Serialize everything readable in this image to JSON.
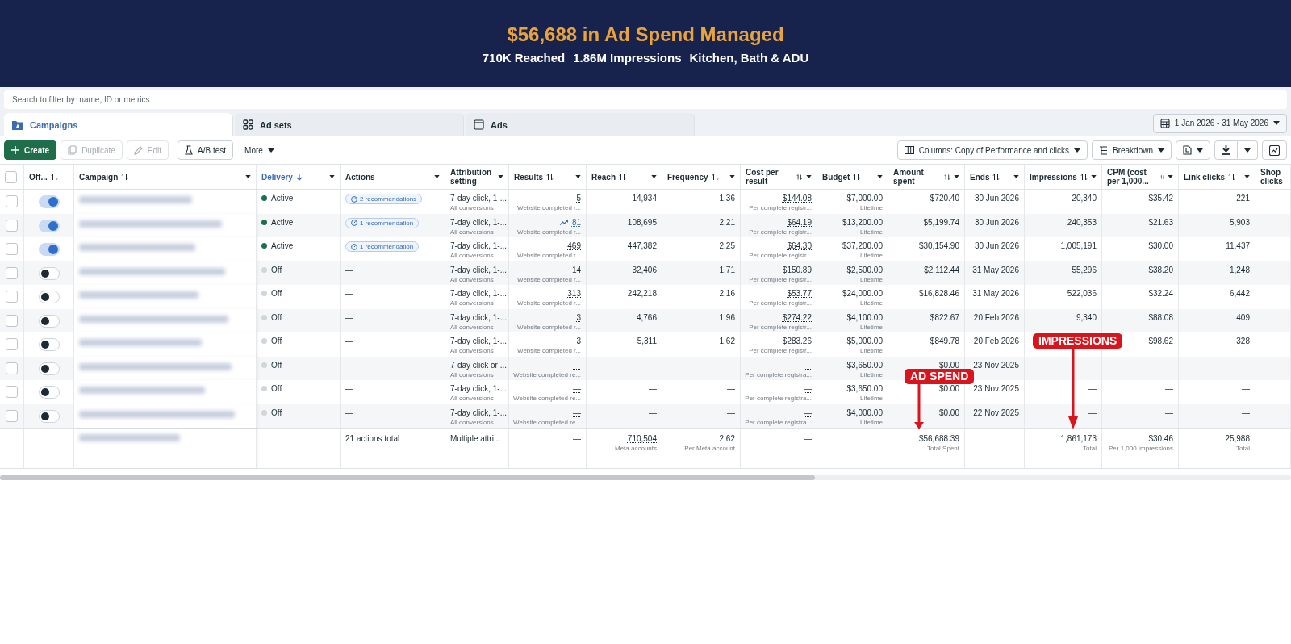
{
  "banner": {
    "title": "$56,688 in Ad Spend Managed",
    "stats": [
      "710K Reached",
      "1.86M Impressions",
      "Kitchen, Bath & ADU"
    ]
  },
  "search": {
    "placeholder": "Search to filter by: name, ID or metrics"
  },
  "tabs": [
    {
      "label": "Campaigns",
      "selected": true
    },
    {
      "label": "Ad sets",
      "selected": false
    },
    {
      "label": "Ads",
      "selected": false
    }
  ],
  "date_range": "1 Jan 2026 - 31 May 2026",
  "toolbar": {
    "create": "Create",
    "duplicate": "Duplicate",
    "edit": "Edit",
    "ab_test": "A/B test",
    "more": "More",
    "columns": "Columns: Copy of Performance and clicks",
    "breakdown": "Breakdown"
  },
  "table": {
    "all_checked": false,
    "columns": [
      {
        "label": "Off...",
        "sortable": true,
        "sorted": false,
        "menu": false
      },
      {
        "label": "Campaign",
        "sortable": true,
        "sorted": false,
        "menu": true
      },
      {
        "label": "Delivery",
        "sortable": true,
        "sorted": true,
        "menu": true
      },
      {
        "label": "Actions",
        "sortable": false,
        "sorted": false,
        "menu": true
      },
      {
        "label": "Attribution setting",
        "sortable": false,
        "sorted": false,
        "menu": true
      },
      {
        "label": "Results",
        "sortable": true,
        "sorted": false,
        "menu": true
      },
      {
        "label": "Reach",
        "sortable": true,
        "sorted": false,
        "menu": true
      },
      {
        "label": "Frequency",
        "sortable": true,
        "sorted": false,
        "menu": true
      },
      {
        "label": "Cost per result",
        "sortable": true,
        "sorted": false,
        "menu": true
      },
      {
        "label": "Budget",
        "sortable": true,
        "sorted": false,
        "menu": true
      },
      {
        "label": "Amount spent",
        "sortable": true,
        "sorted": false,
        "menu": true
      },
      {
        "label": "Ends",
        "sortable": true,
        "sorted": false,
        "menu": true
      },
      {
        "label": "Impressions",
        "sortable": true,
        "sorted": false,
        "menu": true
      },
      {
        "label": "CPM (cost per 1,000...",
        "sortable": true,
        "sorted": false,
        "menu": true
      },
      {
        "label": "Link clicks",
        "sortable": true,
        "sorted": false,
        "menu": true
      },
      {
        "label": "Shop clicks",
        "sorted": false
      }
    ],
    "rows": [
      {
        "on": true,
        "active": true,
        "delivery": "Active",
        "actions": {
          "kind": "recommendation",
          "text": "2 recommendations"
        },
        "attribution": "7-day click, 1-...",
        "attribution_sub": "All conversions",
        "results": "5",
        "trend": false,
        "results_sub": "Website completed r...",
        "reach": "14,934",
        "frequency": "1.36",
        "cost": "$144.08",
        "cost_sub": "Per complete registr...",
        "budget": "$7,000.00",
        "budget_sub": "Lifetime",
        "amount": "$720.40",
        "ends": "30 Jun 2026",
        "impressions": "20,340",
        "cpm": "$35.42",
        "link_clicks": "221",
        "checked": false
      },
      {
        "on": true,
        "active": true,
        "delivery": "Active",
        "actions": {
          "kind": "recommendation",
          "text": "1 recommendation"
        },
        "attribution": "7-day click, 1-...",
        "attribution_sub": "All conversions",
        "results": "81",
        "trend": true,
        "results_sub": "Website completed r...",
        "reach": "108,695",
        "frequency": "2.21",
        "cost": "$64.19",
        "cost_sub": "Per complete registr...",
        "budget": "$13,200.00",
        "budget_sub": "Lifetime",
        "amount": "$5,199.74",
        "ends": "30 Jun 2026",
        "impressions": "240,353",
        "cpm": "$21.63",
        "link_clicks": "5,903",
        "checked": false
      },
      {
        "on": true,
        "active": true,
        "delivery": "Active",
        "actions": {
          "kind": "recommendation",
          "text": "1 recommendation"
        },
        "attribution": "7-day click, 1-...",
        "attribution_sub": "All conversions",
        "results": "469",
        "trend": false,
        "results_sub": "Website completed r...",
        "reach": "447,382",
        "frequency": "2.25",
        "cost": "$64.30",
        "cost_sub": "Per complete registr...",
        "budget": "$37,200.00",
        "budget_sub": "Lifetime",
        "amount": "$30,154.90",
        "ends": "30 Jun 2026",
        "impressions": "1,005,191",
        "cpm": "$30.00",
        "link_clicks": "11,437",
        "checked": false
      },
      {
        "on": false,
        "active": false,
        "delivery": "Off",
        "actions": {
          "kind": "text",
          "text": "—"
        },
        "attribution": "7-day click, 1-...",
        "attribution_sub": "All conversions",
        "results": "14",
        "trend": false,
        "results_sub": "Website completed r...",
        "reach": "32,406",
        "frequency": "1.71",
        "cost": "$150.89",
        "cost_sub": "Per complete registr...",
        "budget": "$2,500.00",
        "budget_sub": "Lifetime",
        "amount": "$2,112.44",
        "ends": "31 May 2026",
        "impressions": "55,296",
        "cpm": "$38.20",
        "link_clicks": "1,248",
        "checked": false
      },
      {
        "on": false,
        "active": false,
        "delivery": "Off",
        "actions": {
          "kind": "text",
          "text": "—"
        },
        "attribution": "7-day click, 1-...",
        "attribution_sub": "All conversions",
        "results": "313",
        "trend": false,
        "results_sub": "Website completed r...",
        "reach": "242,218",
        "frequency": "2.16",
        "cost": "$53.77",
        "cost_sub": "Per complete registr...",
        "budget": "$24,000.00",
        "budget_sub": "Lifetime",
        "amount": "$16,828.46",
        "ends": "31 May 2026",
        "impressions": "522,036",
        "cpm": "$32.24",
        "link_clicks": "6,442",
        "checked": false
      },
      {
        "on": false,
        "active": false,
        "delivery": "Off",
        "actions": {
          "kind": "text",
          "text": "—"
        },
        "attribution": "7-day click, 1-...",
        "attribution_sub": "All conversions",
        "results": "3",
        "trend": false,
        "results_sub": "Website completed r...",
        "reach": "4,766",
        "frequency": "1.96",
        "cost": "$274.22",
        "cost_sub": "Per complete registr...",
        "budget": "$4,100.00",
        "budget_sub": "Lifetime",
        "amount": "$822.67",
        "ends": "20 Feb 2026",
        "impressions": "9,340",
        "cpm": "$88.08",
        "link_clicks": "409",
        "checked": false
      },
      {
        "on": false,
        "active": false,
        "delivery": "Off",
        "actions": {
          "kind": "text",
          "text": "—"
        },
        "attribution": "7-day click, 1-...",
        "attribution_sub": "All conversions",
        "results": "3",
        "trend": false,
        "results_sub": "Website completed r...",
        "reach": "5,311",
        "frequency": "1.62",
        "cost": "$283.26",
        "cost_sub": "Per complete registr...",
        "budget": "$5,000.00",
        "budget_sub": "Lifetime",
        "amount": "$849.78",
        "ends": "20 Feb 2026",
        "cpm": "$98.62",
        "link_clicks": "328",
        "checked": false
      },
      {
        "on": false,
        "active": false,
        "delivery": "Off",
        "actions": {
          "kind": "text",
          "text": "—"
        },
        "checked": false,
        "attribution": "7-day click or ...",
        "attribution_sub": "All conversions",
        "results": "—",
        "trend": false,
        "results_sub": "Website completed re...",
        "reach": "—",
        "frequency": "—",
        "cost": "—",
        "cost_sub": "Per complete registra...",
        "budget": "$3,650.00",
        "budget_sub": "Lifetime",
        "amount": "$0.00",
        "ends": "23 Nov 2025",
        "impressions": "—",
        "cpm": "—",
        "link_clicks": "—"
      },
      {
        "on": false,
        "checked": false,
        "active": false,
        "delivery": "Off",
        "actions": {
          "kind": "text",
          "text": "—"
        },
        "attribution": "7-day click, 1-...",
        "attribution_sub": "All conversions",
        "results": "—",
        "trend": false,
        "results_sub": "Website completed re...",
        "reach": "—",
        "frequency": "—",
        "cost": "—",
        "cost_sub": "Per complete registra...",
        "budget": "$3,650.00",
        "budget_sub": "Lifetime",
        "amount": "$0.00",
        "ends": "23 Nov 2025",
        "impressions": "—",
        "cpm": "—",
        "link_clicks": "—"
      },
      {
        "on": false,
        "checked": false,
        "active": false,
        "delivery": "Off",
        "actions": {
          "kind": "text",
          "text": "—"
        },
        "attribution": "7-day click, 1-...",
        "attribution_sub": "All conversions",
        "results": "—",
        "trend": false,
        "results_sub": "Website completed re...",
        "reach": "—",
        "frequency": "—",
        "cost": "—",
        "cost_sub": "Per complete registra...",
        "budget": "$4,000.00",
        "budget_sub": "Lifetime",
        "amount": "$0.00",
        "ends": "22 Nov 2025",
        "impressions": "—",
        "cpm": "—",
        "link_clicks": "—"
      }
    ],
    "total": {
      "actions": "21 actions total",
      "attribution": "Multiple attri...",
      "results": "—",
      "reach": "710,504",
      "reach_sub": "Meta accounts",
      "frequency": "2.62",
      "frequency_sub": "Per Meta account",
      "cost": "—",
      "amount": "$56,688.39",
      "amount_sub": "Total Spent",
      "impressions": "1,861,173",
      "impressions_sub": "Total",
      "cpm": "$30.46",
      "cpm_sub": "Per 1,000 Impressions",
      "link_clicks": "25,988",
      "link_clicks_sub": "Total"
    }
  },
  "annotations": [
    {
      "label": "AD SPEND"
    },
    {
      "label": "IMPRESSIONS"
    }
  ]
}
